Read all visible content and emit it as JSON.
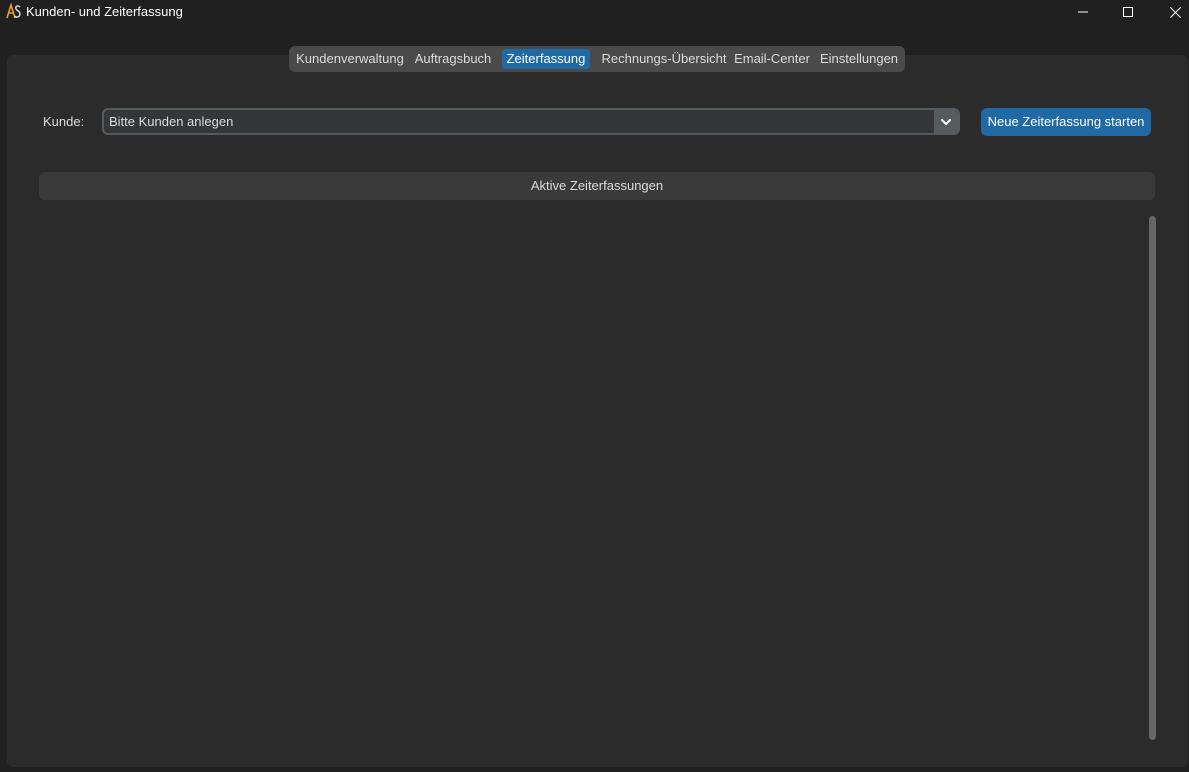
{
  "window": {
    "title": "Kunden- und Zeiterfassung",
    "logo_icon": "app-logo-icon",
    "controls": [
      "minimize-icon",
      "maximize-icon",
      "close-icon"
    ]
  },
  "tabs": [
    {
      "label": "Kundenverwaltung",
      "active": false
    },
    {
      "label": "Auftragsbuch",
      "active": false
    },
    {
      "label": "Zeiterfassung",
      "active": true
    },
    {
      "label": "Rechnungs-Übersicht",
      "active": false
    },
    {
      "label": "Email-Center",
      "active": false
    },
    {
      "label": "Einstellungen",
      "active": false
    }
  ],
  "customer": {
    "label": "Kunde:",
    "selected": "Bitte Kunden anlegen",
    "dropdown_icon": "chevron-down-icon"
  },
  "actions": {
    "start_label": "Neue Zeiterfassung starten"
  },
  "active_section": {
    "title": "Aktive Zeiterfassungen",
    "items": []
  },
  "colors": {
    "accent": "#1f6aa5",
    "background": "#202020",
    "panel": "#2b2b2b"
  }
}
